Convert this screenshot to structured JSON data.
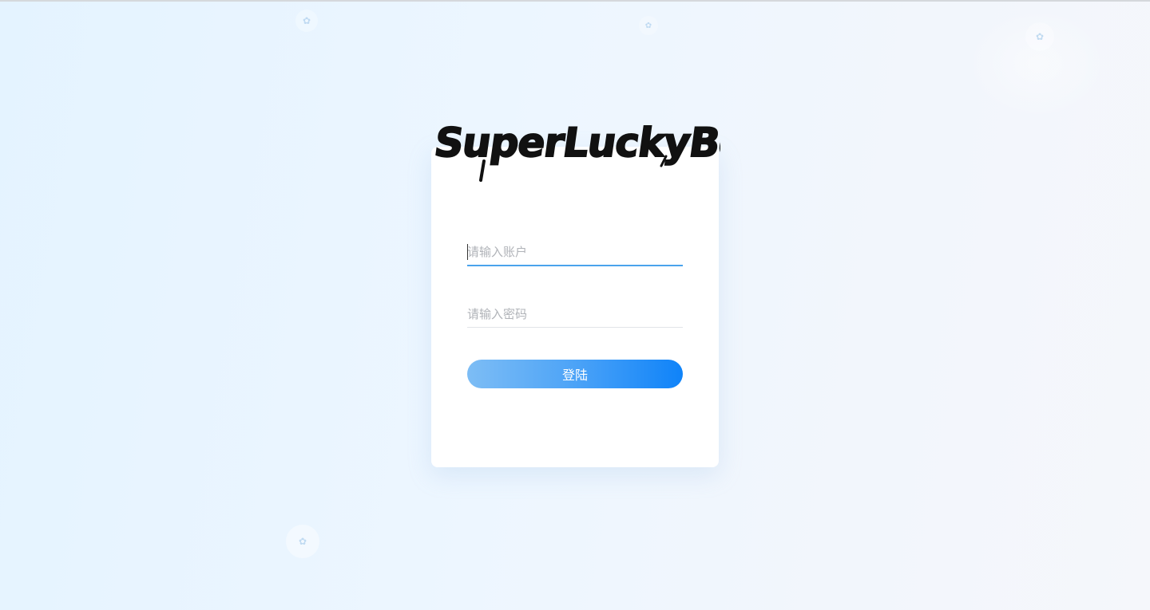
{
  "brand": {
    "logo_text": "SuperLuckyBo"
  },
  "login": {
    "account_placeholder": "请输入账户",
    "password_placeholder": "请输入密码",
    "submit_label": "登陆"
  },
  "decorations": {
    "icon_names": [
      "decor-icon",
      "decor-icon",
      "decor-icon",
      "decor-icon"
    ]
  },
  "colors": {
    "accent": "#409eff",
    "button_gradient_start": "#7dbdf5",
    "button_gradient_end": "#0f83f9",
    "background": "#e9f4ff"
  }
}
